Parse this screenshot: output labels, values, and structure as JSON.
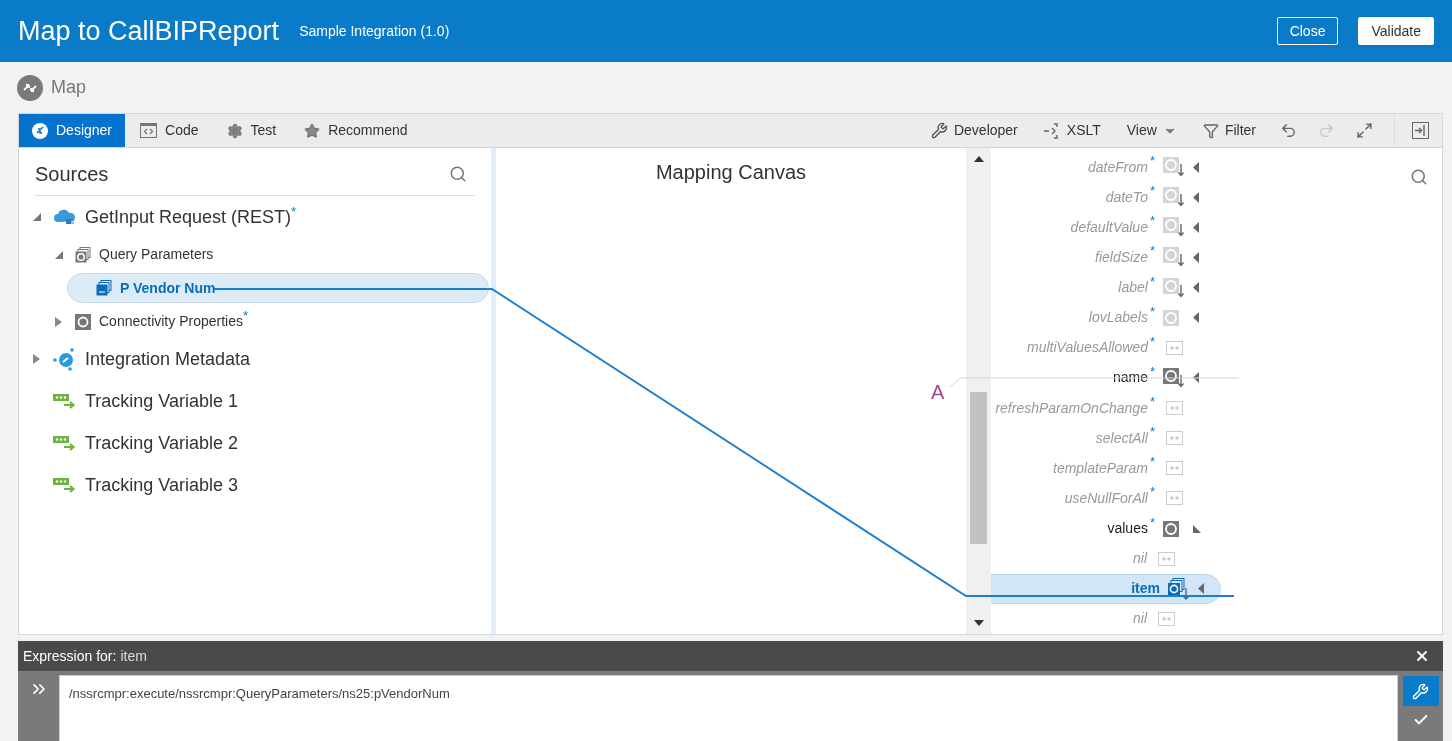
{
  "header": {
    "title": "Map to CallBIPReport",
    "subtitle": "Sample Integration (1.0)",
    "buttons": [
      {
        "label": "Close",
        "kind": "outline"
      },
      {
        "label": "Validate",
        "kind": "solid"
      }
    ]
  },
  "breadcrumb": {
    "label": "Map"
  },
  "toolbar": {
    "tabs": [
      {
        "label": "Designer",
        "selected": true
      },
      {
        "label": "Code",
        "selected": false
      },
      {
        "label": "Test",
        "selected": false
      },
      {
        "label": "Recommend",
        "selected": false
      }
    ],
    "actions": [
      {
        "label": "Developer"
      },
      {
        "label": "XSLT"
      },
      {
        "label": "View"
      },
      {
        "label": "Filter"
      }
    ],
    "icon_buttons": [
      {
        "disabled": false
      },
      {
        "disabled": true
      },
      {
        "disabled": false
      },
      {
        "disabled": false
      }
    ]
  },
  "sources": {
    "title": "Sources",
    "tree": [
      {
        "label": "GetInput Request (REST)",
        "mark": "*",
        "kind": "cloud",
        "expanded": true,
        "children": [
          {
            "label": "Query Parameters",
            "kind": "repeat",
            "expanded": true,
            "children": [
              {
                "label": "P Vendor Num",
                "kind": "text-repeat",
                "selected": true
              }
            ]
          },
          {
            "label": "Connectivity Properties",
            "mark": "*",
            "kind": "element",
            "expanded": false
          }
        ]
      },
      {
        "label": "Integration Metadata",
        "kind": "metadata",
        "expanded": false
      },
      {
        "label": "Tracking Variable 1",
        "kind": "tracking"
      },
      {
        "label": "Tracking Variable 2",
        "kind": "tracking"
      },
      {
        "label": "Tracking Variable 3",
        "kind": "tracking"
      }
    ]
  },
  "canvas": {
    "title": "Mapping Canvas",
    "function_label": "A"
  },
  "target": {
    "items": [
      {
        "label": "dateFrom",
        "mark": "*",
        "kind": "element-leaf",
        "mapped": false,
        "expanded": false
      },
      {
        "label": "dateTo",
        "mark": "*",
        "kind": "element-leaf",
        "mapped": false,
        "expanded": false
      },
      {
        "label": "defaultValue",
        "mark": "*",
        "kind": "element-leaf",
        "mapped": false,
        "expanded": false
      },
      {
        "label": "fieldSize",
        "mark": "*",
        "kind": "element-leaf",
        "mapped": false,
        "expanded": false
      },
      {
        "label": "label",
        "mark": "*",
        "kind": "element-leaf",
        "mapped": false,
        "expanded": false
      },
      {
        "label": "lovLabels",
        "mark": "*",
        "kind": "element",
        "mapped": false,
        "expanded": false
      },
      {
        "label": "multiValuesAllowed",
        "mark": "*",
        "kind": "attribute",
        "mapped": false
      },
      {
        "label": "name",
        "mark": "*",
        "kind": "element-leaf",
        "mapped": true,
        "expanded": false
      },
      {
        "label": "refreshParamOnChange",
        "mark": "*",
        "kind": "attribute",
        "mapped": false
      },
      {
        "label": "selectAll",
        "mark": "*",
        "kind": "attribute",
        "mapped": false
      },
      {
        "label": "templateParam",
        "mark": "*",
        "kind": "attribute",
        "mapped": false
      },
      {
        "label": "useNullForAll",
        "mark": "*",
        "kind": "attribute",
        "mapped": false
      },
      {
        "label": "values",
        "mark": "*",
        "kind": "element",
        "mapped": true,
        "expanded": true,
        "children": [
          {
            "label": "nil",
            "kind": "attribute",
            "mapped": false
          },
          {
            "label": "item",
            "kind": "element-repeat",
            "mapped": true,
            "selected": true,
            "expanded": false
          },
          {
            "label": "nil",
            "kind": "attribute",
            "mapped": false
          }
        ]
      }
    ]
  },
  "expression": {
    "label": "Expression for:",
    "target": "item",
    "value": "/nssrcmpr:execute/nssrcmpr:QueryParameters/ns25:pVendorNum"
  }
}
